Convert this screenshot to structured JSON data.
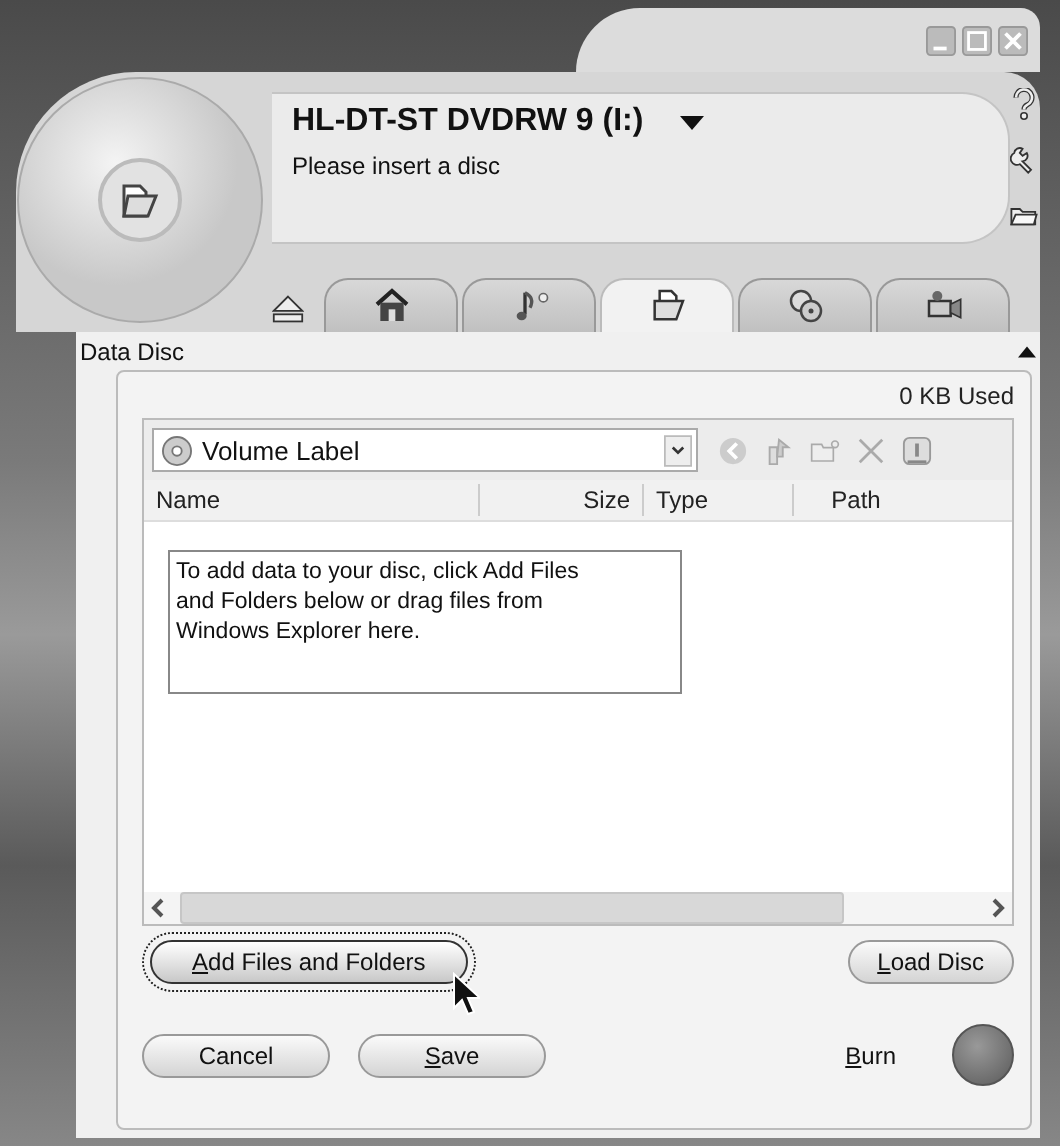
{
  "drive": {
    "name": "HL-DT-ST DVDRW 9 (I:)",
    "status": "Please insert a disc"
  },
  "tabs": [
    {
      "kind": "home",
      "selected": false
    },
    {
      "kind": "music",
      "selected": false
    },
    {
      "kind": "data",
      "selected": true
    },
    {
      "kind": "copy",
      "selected": false
    },
    {
      "kind": "video",
      "selected": false
    }
  ],
  "panel": {
    "title": "Data Disc",
    "usage": "0 KB Used",
    "volume_label": "Volume Label",
    "columns": [
      "Name",
      "Size",
      "Type",
      "Path"
    ],
    "hint": "To add data to your disc, click Add Files and Folders below or drag files from Windows Explorer here."
  },
  "buttons": [
    {
      "kind": "add",
      "label": "Add Files and Folders",
      "access_key": true,
      "focused": true
    },
    {
      "kind": "load",
      "label": "Load Disc",
      "access_key": true,
      "focused": false
    },
    {
      "kind": "cancel",
      "label": "Cancel",
      "access_key": false,
      "focused": false
    },
    {
      "kind": "save",
      "label": "Save",
      "access_key": true,
      "focused": false
    },
    {
      "kind": "burn",
      "label": "Burn",
      "access_key": true,
      "focused": false
    }
  ]
}
